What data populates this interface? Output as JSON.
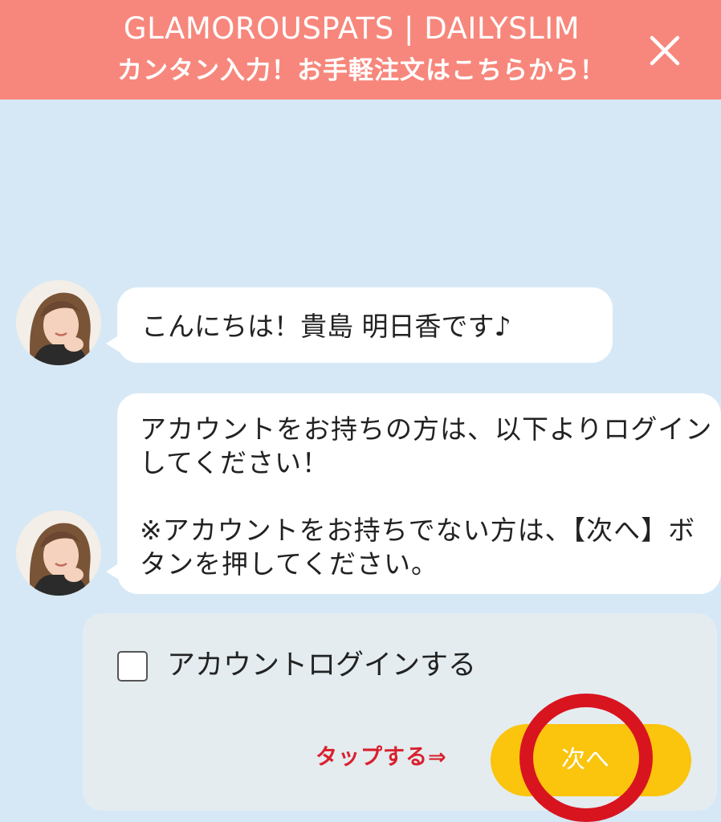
{
  "header": {
    "title": "GLAMOROUSPATS | DAILYSLIM",
    "subtitle": "カンタン入力！お手軽注文はこちらから！",
    "close_icon": "close-icon",
    "background_color": "#f7877c"
  },
  "chat": {
    "avatar_icon": "avatar",
    "messages": [
      {
        "text": "こんにちは！貴島 明日香です♪"
      },
      {
        "text": "アカウントをお持ちの方は、以下よりログインしてください！\n\n※アカウントをお持ちでない方は、【次へ】ボタンを押してください。"
      }
    ]
  },
  "form": {
    "checkbox_label": "アカウントログインする",
    "checkbox_checked": false,
    "tap_hint": "タップする⇒",
    "next_button_label": "次へ",
    "next_button_color": "#fbc40d",
    "highlight_color": "#d8141f"
  }
}
